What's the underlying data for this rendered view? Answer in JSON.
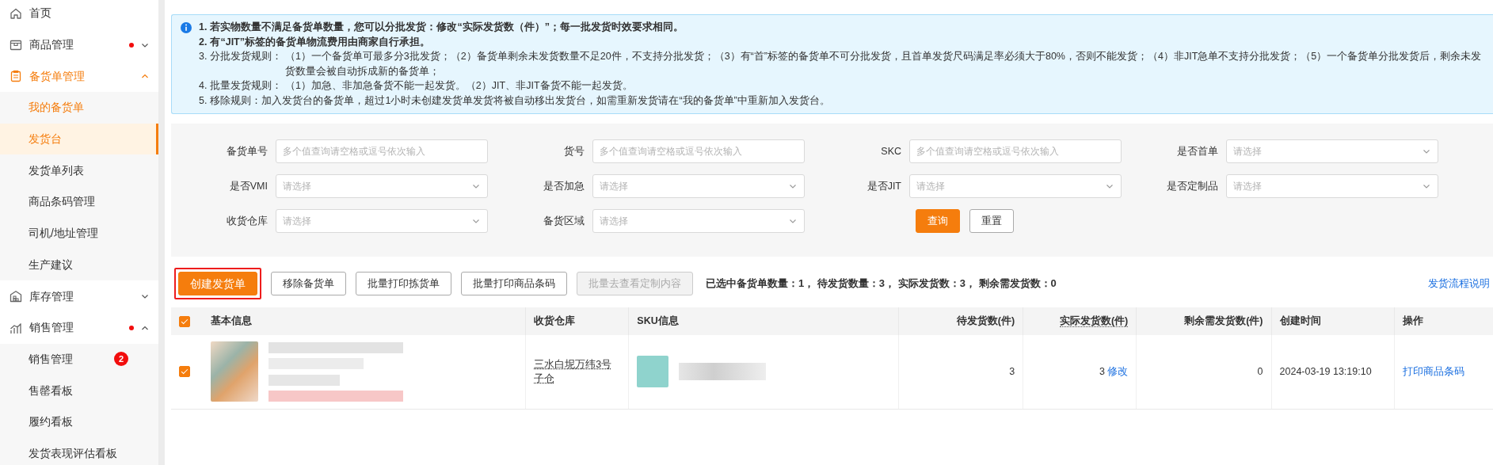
{
  "sidebar": {
    "items": [
      {
        "label": "首页",
        "dot": false,
        "selected": false
      },
      {
        "label": "商品管理",
        "dot": true,
        "expanded": false,
        "selected": false
      },
      {
        "label": "备货单管理",
        "dot": false,
        "expanded": true,
        "selected": true,
        "children": [
          {
            "label": "我的备货单",
            "selected": false,
            "highlighted": true
          },
          {
            "label": "发货台",
            "selected": true,
            "highlighted": true
          },
          {
            "label": "发货单列表",
            "selected": false,
            "highlighted": false
          },
          {
            "label": "商品条码管理",
            "selected": false,
            "highlighted": false
          },
          {
            "label": "司机/地址管理",
            "selected": false,
            "highlighted": false
          },
          {
            "label": "生产建议",
            "selected": false,
            "highlighted": false
          }
        ]
      },
      {
        "label": "库存管理",
        "dot": false,
        "expanded": false,
        "selected": false
      },
      {
        "label": "销售管理",
        "dot": true,
        "expanded": true,
        "selected": false,
        "children": [
          {
            "label": "销售管理",
            "selected": false,
            "highlighted": false,
            "badge": "2"
          },
          {
            "label": "售罄看板",
            "selected": false,
            "highlighted": false
          },
          {
            "label": "履约看板",
            "selected": false,
            "highlighted": false
          },
          {
            "label": "发货表现评估看板",
            "selected": false,
            "highlighted": false
          }
        ]
      }
    ]
  },
  "notice": {
    "lines": [
      {
        "label": "1.",
        "text": "若实物数量不满足备货单数量，您可以分批发货：修改“实际发货数（件）”；每一批发货时效要求相同。",
        "bold": true
      },
      {
        "label": "2.",
        "text": "有“JIT”标签的备货单物流费用由商家自行承担。",
        "bold": true
      },
      {
        "label": "3. 分批发货规则：",
        "text": "（1）一个备货单可最多分3批发货；（2）备货单剩余未发货数量不足20件，不支持分批发货；（3）有“首”标签的备货单不可分批发货，且首单发货尺码满足率必须大于80%，否则不能发货；（4）非JIT急单不支持分批发货；（5）一个备货单分批发货后，剩余未发货数量会被自动拆成新的备货单；",
        "bold": false
      },
      {
        "label": "4. 批量发货规则：",
        "text": "（1）加急、非加急备货不能一起发货。（2）JIT、非JIT备货不能一起发货。",
        "bold": false
      },
      {
        "label": "5.",
        "text": "移除规则：加入发货台的备货单，超过1小时未创建发货单发货将被自动移出发货台，如需重新发货请在“我的备货单”中重新加入发货台。",
        "bold": false
      }
    ]
  },
  "filters": [
    {
      "label": "备货单号",
      "kind": "text",
      "placeholder": "多个值查询请空格或逗号依次输入"
    },
    {
      "label": "货号",
      "kind": "text",
      "placeholder": "多个值查询请空格或逗号依次输入"
    },
    {
      "label": "SKC",
      "kind": "text",
      "placeholder": "多个值查询请空格或逗号依次输入"
    },
    {
      "label": "是否首单",
      "kind": "select",
      "placeholder": "请选择"
    },
    {
      "label": "是否VMI",
      "kind": "select",
      "placeholder": "请选择"
    },
    {
      "label": "是否加急",
      "kind": "select",
      "placeholder": "请选择"
    },
    {
      "label": "是否JIT",
      "kind": "select",
      "placeholder": "请选择"
    },
    {
      "label": "是否定制品",
      "kind": "select",
      "placeholder": "请选择"
    },
    {
      "label": "收货仓库",
      "kind": "select",
      "placeholder": "请选择"
    },
    {
      "label": "备货区域",
      "kind": "select",
      "placeholder": "请选择"
    }
  ],
  "filter_buttons": [
    {
      "label": "查询",
      "kind": "primary"
    },
    {
      "label": "重置",
      "kind": "default"
    }
  ],
  "toolbar": {
    "buttons": [
      {
        "label": "创建发货单",
        "kind": "primary",
        "disabled": false,
        "highlighted": true
      },
      {
        "label": "移除备货单",
        "kind": "default",
        "disabled": false,
        "highlighted": false
      },
      {
        "label": "批量打印拣货单",
        "kind": "default",
        "disabled": false,
        "highlighted": false
      },
      {
        "label": "批量打印商品条码",
        "kind": "default",
        "disabled": false,
        "highlighted": false
      },
      {
        "label": "批量去查看定制内容",
        "kind": "default",
        "disabled": true,
        "highlighted": false
      }
    ],
    "summary": "已选中备货单数量：1， 待发货数量：3， 实际发货数：3， 剩余需发货数：0",
    "link": "发货流程说明"
  },
  "table": {
    "all_checked": true,
    "columns": [
      {
        "label": "基本信息",
        "dotted": false
      },
      {
        "label": "收货仓库",
        "dotted": false
      },
      {
        "label": "SKU信息",
        "dotted": false
      },
      {
        "label": "待发货数(件)",
        "dotted": false
      },
      {
        "label": "实际发货数(件)",
        "dotted": true
      },
      {
        "label": "剩余需发货数(件)",
        "dotted": false
      },
      {
        "label": "创建时间",
        "dotted": false
      },
      {
        "label": "操作",
        "dotted": false
      }
    ],
    "rows": [
      {
        "checked": true,
        "warehouse": "三水白坭万纬3号子仓",
        "pending": "3",
        "actual": "3",
        "edit_link": "修改",
        "remaining": "0",
        "created": "2024-03-19 13:19:10",
        "action": "打印商品条码"
      }
    ]
  }
}
